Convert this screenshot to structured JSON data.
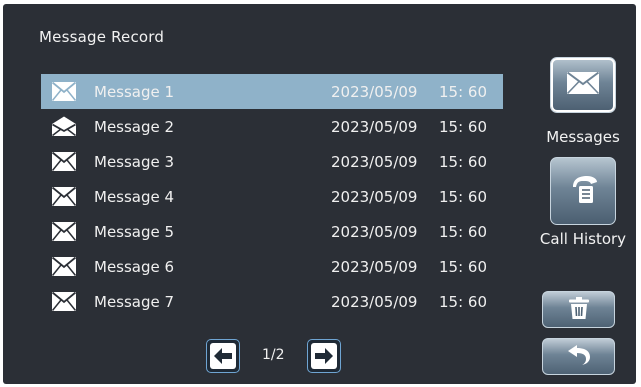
{
  "header": {
    "title": "Message Record"
  },
  "messages": [
    {
      "name": "Message 1",
      "date": "2023/05/09",
      "time": "15: 60",
      "read": false,
      "selected": true
    },
    {
      "name": "Message 2",
      "date": "2023/05/09",
      "time": "15: 60",
      "read": true,
      "selected": false
    },
    {
      "name": "Message 3",
      "date": "2023/05/09",
      "time": "15: 60",
      "read": false,
      "selected": false
    },
    {
      "name": "Message 4",
      "date": "2023/05/09",
      "time": "15: 60",
      "read": false,
      "selected": false
    },
    {
      "name": "Message 5",
      "date": "2023/05/09",
      "time": "15: 60",
      "read": false,
      "selected": false
    },
    {
      "name": "Message 6",
      "date": "2023/05/09",
      "time": "15: 60",
      "read": false,
      "selected": false
    },
    {
      "name": "Message 7",
      "date": "2023/05/09",
      "time": "15: 60",
      "read": false,
      "selected": false
    }
  ],
  "pager": {
    "label": "1/2",
    "prev_icon": "arrow-left-icon",
    "next_icon": "arrow-right-icon"
  },
  "sidebar": {
    "messages_label": "Messages",
    "call_history_label": "Call History",
    "messages_icon": "envelope-icon",
    "call_history_icon": "phone-icon",
    "delete_icon": "trash-icon",
    "back_icon": "back-arrow-icon"
  },
  "colors": {
    "background": "#2b2f36",
    "selected_row": "#8fb2c9",
    "button_border": "#6fa5d3"
  }
}
